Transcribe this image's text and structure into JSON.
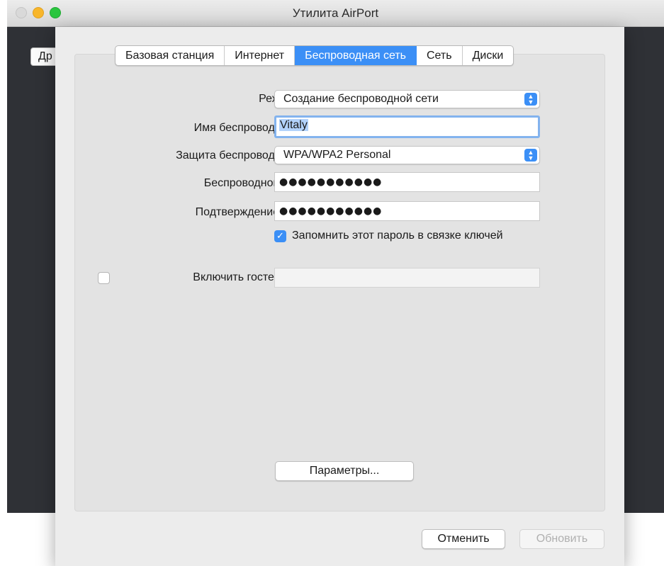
{
  "window": {
    "title": "Утилита AirPort",
    "behind_button": "Др"
  },
  "tabs": [
    {
      "label": "Базовая станция",
      "active": false
    },
    {
      "label": "Интернет",
      "active": false
    },
    {
      "label": "Беспроводная сеть",
      "active": true
    },
    {
      "label": "Сеть",
      "active": false
    },
    {
      "label": "Диски",
      "active": false
    }
  ],
  "form": {
    "network_mode": {
      "label": "Режим сети:",
      "value": "Создание беспроводной сети"
    },
    "network_name": {
      "label": "Имя беспроводной сети:",
      "value": "Vitaly"
    },
    "security": {
      "label": "Защита беспроводной сети:",
      "value": "WPA/WPA2 Personal"
    },
    "password": {
      "label": "Беспроводной пароль:",
      "value": "●●●●●●●●●●●"
    },
    "confirm_password": {
      "label": "Подтверждение пароля:",
      "value": "●●●●●●●●●●●"
    },
    "remember_keychain": {
      "label": "Запомнить этот пароль в связке ключей",
      "checked": true
    },
    "guest_network": {
      "label": "Включить гостевую сеть:",
      "checked": false,
      "value": ""
    }
  },
  "buttons": {
    "options": "Параметры...",
    "cancel": "Отменить",
    "update": "Обновить"
  },
  "colors": {
    "accent": "#3b8ff6",
    "focus_ring": "#83b3ee"
  }
}
